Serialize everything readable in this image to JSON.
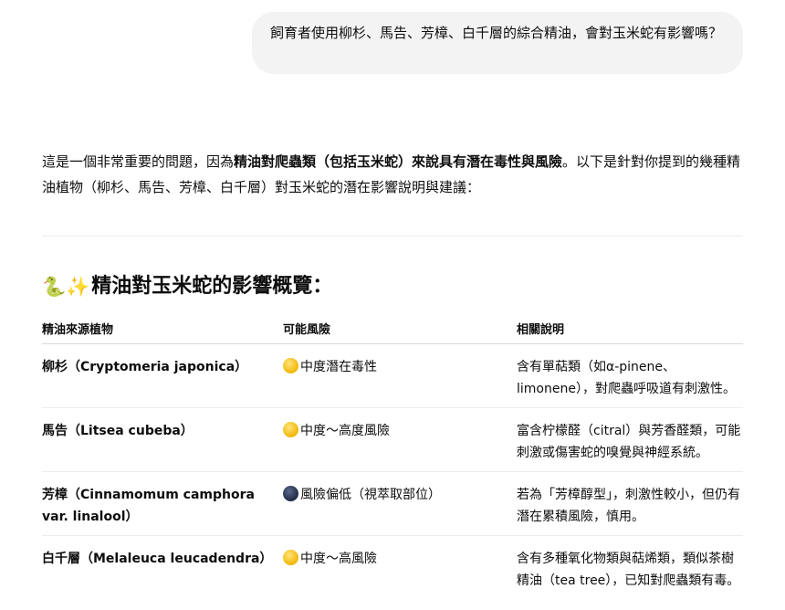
{
  "user_message": "飼育者使用柳杉、馬告、芳樟、白千層的綜合精油，會對玉米蛇有影響嗎？",
  "response": {
    "intro_part1": "這是一個非常重要的問題，因為",
    "intro_bold": "精油對爬蟲類（包括玉米蛇）來說具有潛在毒性與風險",
    "intro_part2": "。以下是針對你提到的幾種精油植物（柳杉、馬告、芳樟、白千層）對玉米蛇的潛在影響說明與建議：",
    "heading_emoji": "🐍✨",
    "heading_text": "精油對玉米蛇的影響概覽：",
    "table": {
      "headers": [
        "精油來源植物",
        "可能風險",
        "相關說明"
      ],
      "rows": [
        {
          "plant": "柳杉（Cryptomeria japonica）",
          "risk_icon": "yellow-circle-icon",
          "risk": "中度潛在毒性",
          "note": "含有單萜類（如α-pinene、limonene），對爬蟲呼吸道有刺激性。"
        },
        {
          "plant": "馬告（Litsea cubeba）",
          "risk_icon": "yellow-circle-icon",
          "risk": "中度～高度風險",
          "note": "富含柠檬醛（citral）與芳香醛類，可能刺激或傷害蛇的嗅覺與神經系統。"
        },
        {
          "plant": "芳樟（Cinnamomum camphora var. linalool）",
          "risk_icon": "dark-circle-icon",
          "risk": "風險偏低（視萃取部位）",
          "note": "若為「芳樟醇型」，刺激性較小，但仍有潛在累積風險，慎用。"
        },
        {
          "plant": "白千層（Melaleuca leucadendra）",
          "risk_icon": "yellow-circle-icon",
          "risk": "中度～高風險",
          "note": "含有多種氧化物類與萜烯類，類似茶樹精油（tea tree），已知對爬蟲類有毒。"
        }
      ]
    }
  },
  "colors": {
    "bubble_bg": "#f3f3f3",
    "yellow": "#f2b705",
    "dark": "#1f2a44",
    "text": "#0d0d0d"
  }
}
